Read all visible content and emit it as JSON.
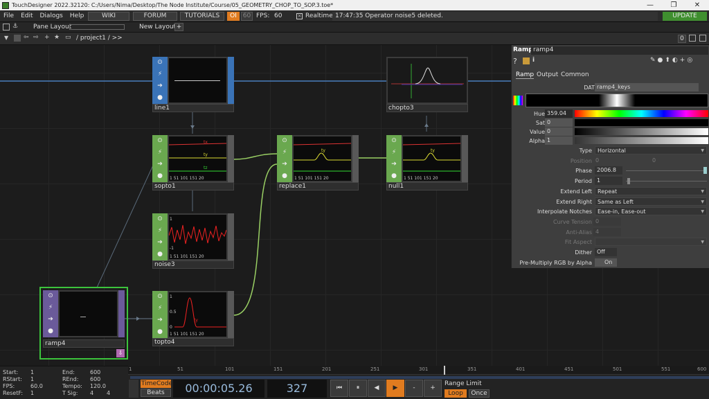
{
  "window": {
    "title": "TouchDesigner 2022.32120: C:/Users/Nima/Desktop/The Node Institute/Course/05_GEOMETRY_CHOP_TO_SOP.3.toe*",
    "minimize": "—",
    "maximize": "❐",
    "close": "✕"
  },
  "menu": [
    "File",
    "Edit",
    "Dialogs",
    "Help"
  ],
  "toolbar": {
    "wiki": "WIKI",
    "forum": "FORUM",
    "tutorials": "TUTORIALS",
    "oi": "OI",
    "fps_set": "60",
    "fps_label": "FPS:",
    "fps_value": "60",
    "realtime": "Realtime",
    "status": "17:47:35 Operator noise5 deleted.",
    "update": "UPDATE"
  },
  "pane_bar": {
    "pane_layout": "Pane Layout",
    "new_layout": "New Layout",
    "new_layout_plus": "+"
  },
  "path_bar": {
    "path": "/ project1 / >>",
    "zero": "0"
  },
  "nodes": [
    {
      "name": "line1",
      "family": "SOP"
    },
    {
      "name": "chopto3",
      "family": "DAT"
    },
    {
      "name": "sopto1",
      "family": "CHOP"
    },
    {
      "name": "replace1",
      "family": "CHOP"
    },
    {
      "name": "null1",
      "family": "CHOP"
    },
    {
      "name": "noise3",
      "family": "CHOP"
    },
    {
      "name": "ramp4",
      "family": "TOP"
    },
    {
      "name": "topto4",
      "family": "CHOP"
    }
  ],
  "chop_view": {
    "tx": "tx",
    "ty": "ty",
    "tz": "tz",
    "y1": "1",
    "y0": "0",
    "ym1": "-1",
    "y05": "0.5",
    "xticks": [
      "1",
      "51",
      "101",
      "151",
      "20"
    ]
  },
  "params": {
    "op_type": "Ramp",
    "op_name": "ramp4",
    "tabs": [
      "Ramp",
      "Output",
      "Common"
    ],
    "dat_label": "DAT",
    "dat_value": "ramp4_keys",
    "hue_label": "Hue",
    "hue_value": "359.04",
    "sat_label": "Sat",
    "sat_value": "0",
    "value_label": "Value",
    "value_value": "0",
    "alpha_label": "Alpha",
    "alpha_value": "1",
    "type_label": "Type",
    "type_value": "Horizontal",
    "position_label": "Position",
    "position_value1": "0",
    "position_value2": "0",
    "phase_label": "Phase",
    "phase_value": "2006.8",
    "period_label": "Period",
    "period_value": "1",
    "extend_left_label": "Extend Left",
    "extend_left_value": "Repeat",
    "extend_right_label": "Extend Right",
    "extend_right_value": "Same as Left",
    "interp_label": "Interpolate Notches",
    "interp_value": "Ease-in, Ease-out",
    "curve_label": "Curve Tension",
    "curve_value": "0",
    "aa_label": "Anti-Alias",
    "aa_value": "4",
    "fit_label": "Fit Aspect",
    "dither_label": "Dither",
    "dither_value": "Off",
    "premult_label": "Pre-Multiply RGB by Alpha",
    "premult_value": "On"
  },
  "timeline": {
    "ticks": [
      "1",
      "51",
      "101",
      "151",
      "201",
      "251",
      "301",
      "351",
      "401",
      "451",
      "501",
      "551",
      "600"
    ]
  },
  "stats": {
    "start_label": "Start:",
    "start": "1",
    "end_label": "End:",
    "end": "600",
    "rstart_label": "RStart:",
    "rstart": "1",
    "rend_label": "REnd:",
    "rend": "600",
    "fps_label": "FPS:",
    "fps": "60.0",
    "tempo_label": "Tempo:",
    "tempo": "120.0",
    "resetf_label": "ResetF:",
    "resetf": "1",
    "tsig_label": "T Sig:",
    "tsig1": "4",
    "tsig2": "4"
  },
  "transport": {
    "timecode_label": "TimeCode",
    "beats_label": "Beats",
    "timecode": "00:00:05.26",
    "frame": "327",
    "range_limit": "Range Limit",
    "loop": "Loop",
    "once": "Once",
    "minus": "-",
    "plus": "+"
  },
  "colors": {
    "chop": "#6aa84f",
    "top": "#6a5a9a",
    "sop": "#3a73b7",
    "selected": "#3cc43c",
    "accent": "#e07b1f"
  }
}
